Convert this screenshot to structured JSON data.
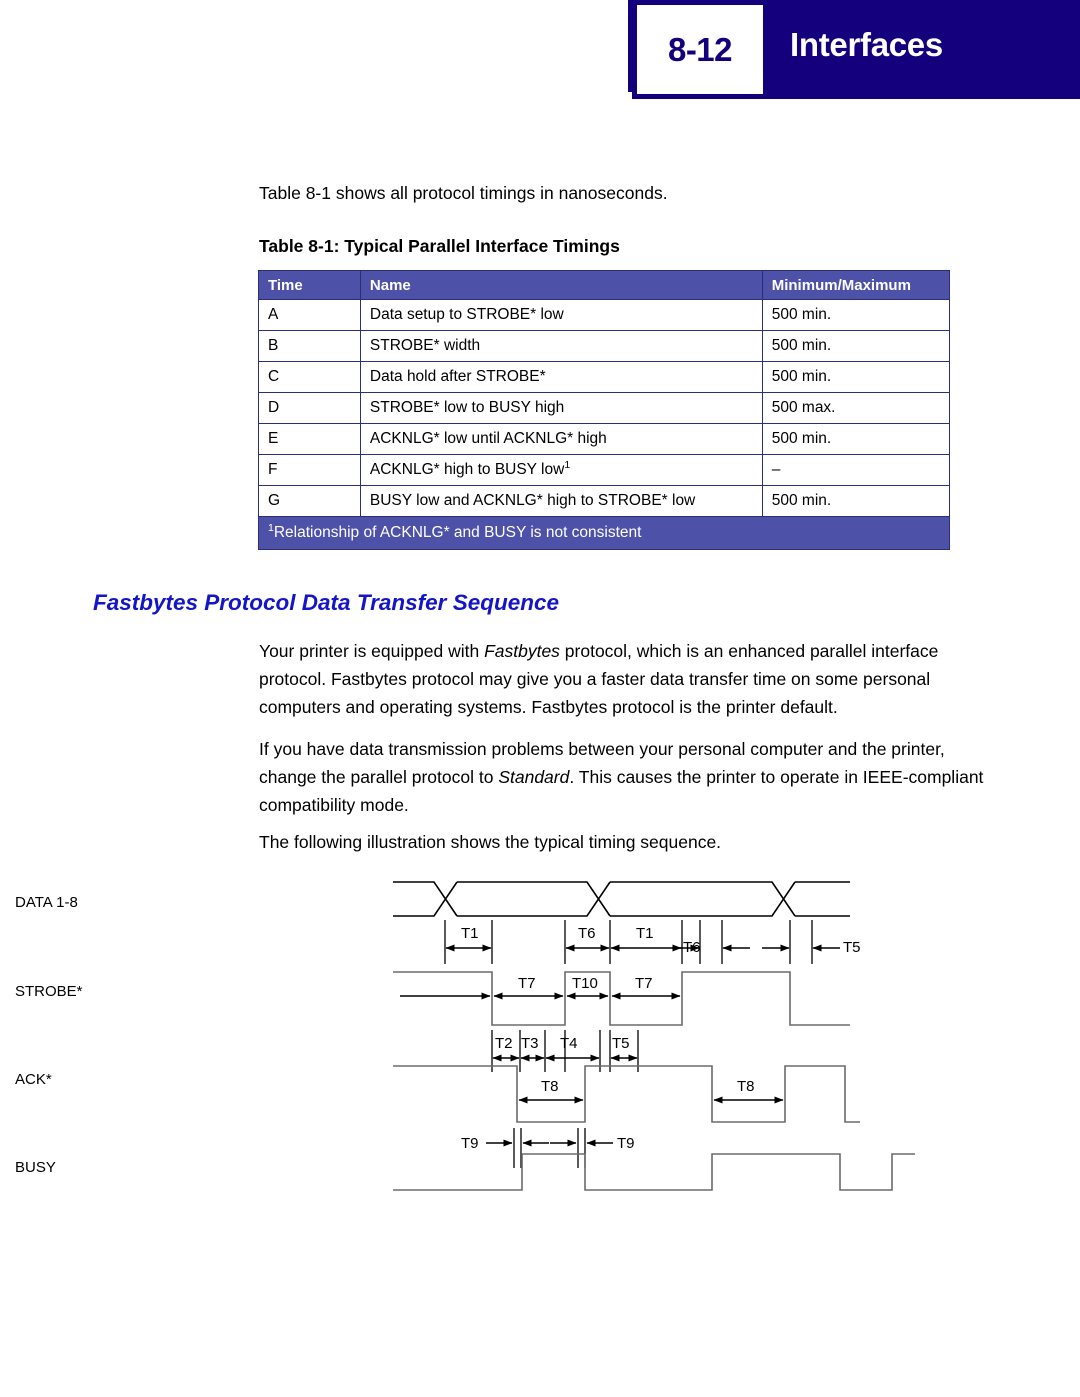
{
  "header": {
    "page_number": "8-12",
    "title": "Interfaces",
    "bar_color": "#14007d"
  },
  "intro": {
    "line": "Table 8-1 shows all protocol timings in nanoseconds."
  },
  "table": {
    "caption": "Table 8-1:  Typical Parallel Interface Timings",
    "header_color": "#4d51a8",
    "columns": [
      "Time",
      "Name",
      "Minimum/Maximum"
    ],
    "rows": [
      {
        "time": "A",
        "name": "Data setup to STROBE* low",
        "minmax": "500 min."
      },
      {
        "time": "B",
        "name": "STROBE* width",
        "minmax": "500 min."
      },
      {
        "time": "C",
        "name": "Data hold after STROBE*",
        "minmax": "500 min."
      },
      {
        "time": "D",
        "name": "STROBE* low to BUSY high",
        "minmax": "500 max."
      },
      {
        "time": "E",
        "name": "ACKNLG* low until ACKNLG* high",
        "minmax": "500 min."
      },
      {
        "time": "F",
        "name": "ACKNLG* high to BUSY low",
        "name_sup": "1",
        "minmax": "–"
      },
      {
        "time": "G",
        "name": "BUSY low and ACKNLG* high to STROBE* low",
        "minmax": "500 min."
      }
    ],
    "footnote_marker": "1",
    "footnote": "Relationship of ACKNLG* and BUSY is not consistent"
  },
  "section": {
    "heading": "Fastbytes Protocol Data Transfer Sequence",
    "heading_color": "#1414c8",
    "paragraph1_a": "Your printer is equipped with ",
    "paragraph1_em": "Fastbytes",
    "paragraph1_b": " protocol, which is an enhanced parallel interface protocol. Fastbytes protocol may give you a faster data transfer time on some personal computers and operating systems. Fastbytes protocol is the printer default.",
    "paragraph2_a": "If you have data transmission problems between your personal computer and the printer, change the parallel protocol to ",
    "paragraph2_em": "Standard",
    "paragraph2_b": ". This causes the printer to operate in IEEE-compliant compatibility mode.",
    "paragraph3": "The following illustration shows the typical timing sequence."
  },
  "diagram": {
    "signals": [
      {
        "name": "DATA 1-8"
      },
      {
        "name": "STROBE*"
      },
      {
        "name": "ACK*"
      },
      {
        "name": "BUSY"
      }
    ],
    "data_row_intervals": [
      "T1",
      "T6",
      "T1",
      "T6",
      "T5"
    ],
    "strobe_row_intervals": [
      "T7",
      "T10",
      "T7"
    ],
    "strobe_sub_intervals": [
      "T2",
      "T3",
      "T4",
      "T5"
    ],
    "ack_row_intervals": [
      "T8",
      "T8"
    ],
    "ack_sub_intervals": [
      "T9",
      "T9"
    ]
  }
}
